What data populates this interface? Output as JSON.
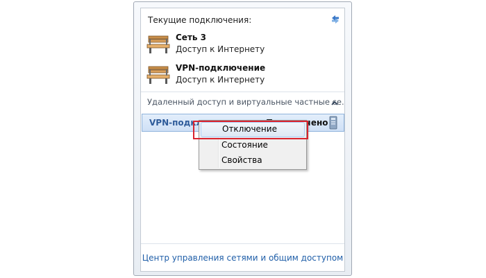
{
  "panel": {
    "current_connections_title": "Текущие подключения:",
    "connections": [
      {
        "name": "Сеть  3",
        "status": "Доступ к Интернету",
        "icon": "network-bench-icon"
      },
      {
        "name": "VPN-подключение",
        "status": "Доступ к Интернету",
        "icon": "network-bench-icon"
      }
    ],
    "section_header": "Удаленный доступ и виртуальные частные се...",
    "vpn_item": {
      "name": "VPN-подключение",
      "state": "Подключено",
      "icon": "vpn-connection-icon"
    },
    "footer_link": "Центр управления сетями и общим доступом"
  },
  "context_menu": {
    "items": [
      {
        "label": "Отключение",
        "highlighted": true
      },
      {
        "label": "Состояние",
        "highlighted": false
      },
      {
        "label": "Свойства",
        "highlighted": false
      }
    ]
  },
  "colors": {
    "link": "#1f5ea8",
    "selection_bg": "#cfe0f6",
    "annotation_red": "#d9232e"
  }
}
